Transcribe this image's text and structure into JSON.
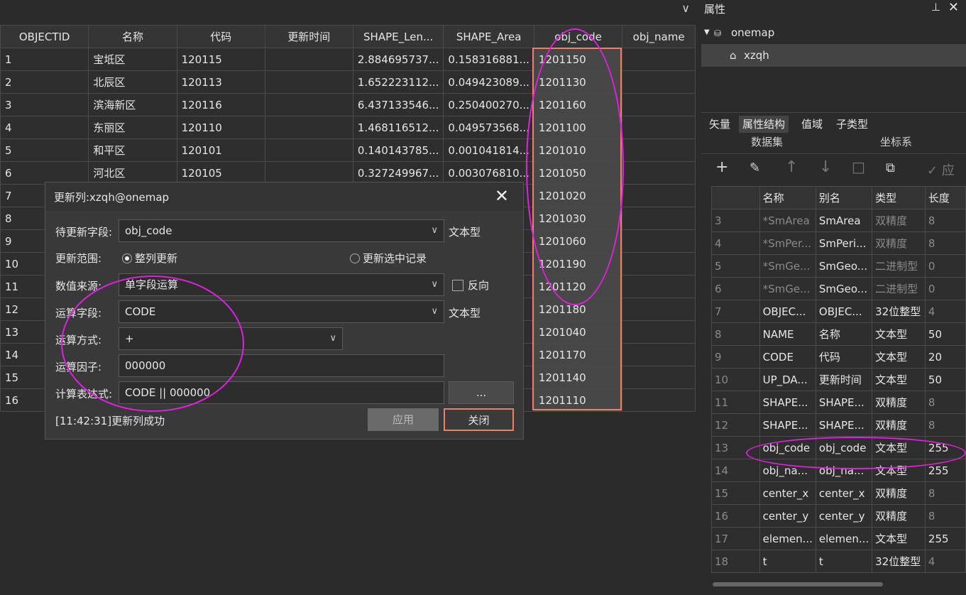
{
  "table": {
    "columns": [
      "OBJECTID",
      "名称",
      "代码",
      "更新时间",
      "SHAPE_Len...",
      "SHAPE_Area",
      "obj_code",
      "obj_name"
    ],
    "rows": [
      [
        "1",
        "宝坻区",
        "120115",
        "",
        "2.884695737...",
        "0.158316881...",
        "1201150",
        ""
      ],
      [
        "2",
        "北辰区",
        "120113",
        "",
        "1.652223112...",
        "0.049423089...",
        "1201130",
        ""
      ],
      [
        "3",
        "滨海新区",
        "120116",
        "",
        "6.437133546...",
        "0.250400270...",
        "1201160",
        ""
      ],
      [
        "4",
        "东丽区",
        "120110",
        "",
        "1.468116512...",
        "0.049573568...",
        "1201100",
        ""
      ],
      [
        "5",
        "和平区",
        "120101",
        "",
        "0.140143785...",
        "0.001041814...",
        "1201010",
        ""
      ],
      [
        "6",
        "河北区",
        "120105",
        "",
        "0.327249967...",
        "0.003076810...",
        "1201050",
        ""
      ],
      [
        "7",
        "",
        "",
        "",
        "",
        "",
        "1201020",
        ""
      ],
      [
        "8",
        "",
        "",
        "",
        "",
        "",
        "1201030",
        ""
      ],
      [
        "9",
        "",
        "",
        "",
        "",
        "",
        "1201060",
        ""
      ],
      [
        "10",
        "",
        "",
        "",
        "",
        "",
        "1201190",
        ""
      ],
      [
        "11",
        "",
        "",
        "",
        "",
        "",
        "1201120",
        ""
      ],
      [
        "12",
        "",
        "",
        "",
        "",
        "",
        "1201180",
        ""
      ],
      [
        "13",
        "",
        "",
        "",
        "",
        "",
        "1201040",
        ""
      ],
      [
        "14",
        "",
        "",
        "",
        "",
        "",
        "1201170",
        ""
      ],
      [
        "15",
        "",
        "",
        "",
        "",
        "",
        "1201140",
        ""
      ],
      [
        "16",
        "",
        "",
        "",
        "",
        "",
        "1201110",
        ""
      ]
    ]
  },
  "dialog": {
    "title": "更新列:xzqh@onemap",
    "field_label": "待更新字段:",
    "field_value": "obj_code",
    "field_type": "文本型",
    "range_label": "更新范围:",
    "range_all": "整列更新",
    "range_selected": "更新选中记录",
    "source_label": "数值来源:",
    "source_value": "单字段运算",
    "reverse_label": "反向",
    "calc_field_label": "运算字段:",
    "calc_field_value": "CODE",
    "calc_field_type": "文本型",
    "op_label": "运算方式:",
    "op_value": "+",
    "factor_label": "运算因子:",
    "factor_value": "000000",
    "expr_label": "计算表达式:",
    "expr_value": "CODE || 000000",
    "dots_label": "...",
    "status": "[11:42:31]更新列成功",
    "apply_label": "应用",
    "close_label": "关闭"
  },
  "panel": {
    "title": "属性",
    "tree_root": "onemap",
    "tree_child": "xzqh",
    "tabs": [
      "矢量",
      "属性结构",
      "值域",
      "子类型"
    ],
    "sub_labels": [
      "数据集",
      "坐标系"
    ],
    "apply_partial": "应",
    "field_columns": [
      "",
      "名称",
      "别名",
      "类型",
      "长度"
    ],
    "field_rows": [
      [
        "3",
        "*SmArea",
        "SmArea",
        "双精度",
        "8"
      ],
      [
        "4",
        "*SmPer...",
        "SmPeri...",
        "双精度",
        "8"
      ],
      [
        "5",
        "*SmGe...",
        "SmGeo...",
        "二进制型",
        "0"
      ],
      [
        "6",
        "*SmGe...",
        "SmGeo...",
        "二进制型",
        "0"
      ],
      [
        "7",
        "OBJEC...",
        "OBJEC...",
        "32位整型",
        "4"
      ],
      [
        "8",
        "NAME",
        "名称",
        "文本型",
        "50"
      ],
      [
        "9",
        "CODE",
        "代码",
        "文本型",
        "20"
      ],
      [
        "10",
        "UP_DA...",
        "更新时间",
        "文本型",
        "50"
      ],
      [
        "11",
        "SHAPE...",
        "SHAPE...",
        "双精度",
        "8"
      ],
      [
        "12",
        "SHAPE...",
        "SHAPE...",
        "双精度",
        "8"
      ],
      [
        "13",
        "obj_code",
        "obj_code",
        "文本型",
        "255"
      ],
      [
        "14",
        "obj_na...",
        "obj_na...",
        "文本型",
        "255"
      ],
      [
        "15",
        "center_x",
        "center_x",
        "双精度",
        "8"
      ],
      [
        "16",
        "center_y",
        "center_y",
        "双精度",
        "8"
      ],
      [
        "17",
        "elemen...",
        "elemen...",
        "文本型",
        "255"
      ],
      [
        "18",
        "t",
        "t",
        "32位整型",
        "4"
      ]
    ]
  },
  "colors": {
    "annotation": "#e020e0",
    "highlight": "#f07f6a"
  }
}
